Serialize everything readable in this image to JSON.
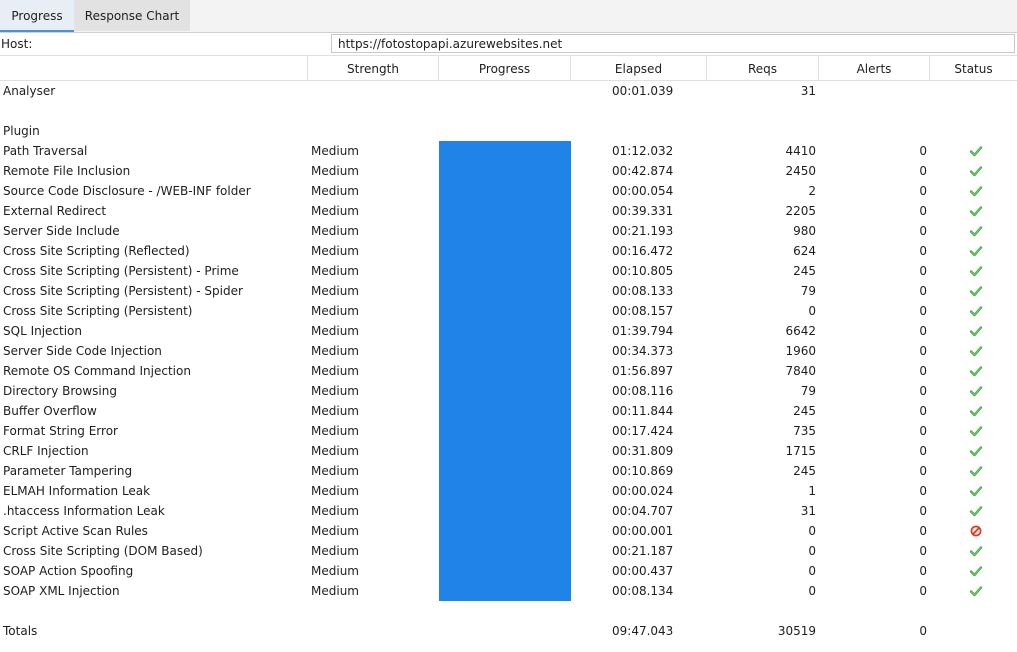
{
  "tabs": [
    {
      "label": "Progress",
      "active": true
    },
    {
      "label": "Response Chart",
      "active": false
    }
  ],
  "host": {
    "label": "Host:",
    "value": "https://fotostopapi.azurewebsites.net"
  },
  "columns": [
    "Strength",
    "Progress",
    "Elapsed",
    "Reqs",
    "Alerts",
    "Status"
  ],
  "analyser": {
    "name": "Analyser",
    "elapsed": "00:01.039",
    "reqs": "31"
  },
  "plugin_header": "Plugin",
  "plugins": [
    {
      "name": "Path Traversal",
      "strength": "Medium",
      "progress": 1.0,
      "elapsed": "01:12.032",
      "reqs": "4410",
      "alerts": "0",
      "status": "ok"
    },
    {
      "name": "Remote File Inclusion",
      "strength": "Medium",
      "progress": 1.0,
      "elapsed": "00:42.874",
      "reqs": "2450",
      "alerts": "0",
      "status": "ok"
    },
    {
      "name": "Source Code Disclosure - /WEB-INF folder",
      "strength": "Medium",
      "progress": 1.0,
      "elapsed": "00:00.054",
      "reqs": "2",
      "alerts": "0",
      "status": "ok"
    },
    {
      "name": "External Redirect",
      "strength": "Medium",
      "progress": 1.0,
      "elapsed": "00:39.331",
      "reqs": "2205",
      "alerts": "0",
      "status": "ok"
    },
    {
      "name": "Server Side Include",
      "strength": "Medium",
      "progress": 1.0,
      "elapsed": "00:21.193",
      "reqs": "980",
      "alerts": "0",
      "status": "ok"
    },
    {
      "name": "Cross Site Scripting (Reflected)",
      "strength": "Medium",
      "progress": 1.0,
      "elapsed": "00:16.472",
      "reqs": "624",
      "alerts": "0",
      "status": "ok"
    },
    {
      "name": "Cross Site Scripting (Persistent) - Prime",
      "strength": "Medium",
      "progress": 1.0,
      "elapsed": "00:10.805",
      "reqs": "245",
      "alerts": "0",
      "status": "ok"
    },
    {
      "name": "Cross Site Scripting (Persistent) - Spider",
      "strength": "Medium",
      "progress": 1.0,
      "elapsed": "00:08.133",
      "reqs": "79",
      "alerts": "0",
      "status": "ok"
    },
    {
      "name": "Cross Site Scripting (Persistent)",
      "strength": "Medium",
      "progress": 1.0,
      "elapsed": "00:08.157",
      "reqs": "0",
      "alerts": "0",
      "status": "ok"
    },
    {
      "name": "SQL Injection",
      "strength": "Medium",
      "progress": 1.0,
      "elapsed": "01:39.794",
      "reqs": "6642",
      "alerts": "0",
      "status": "ok"
    },
    {
      "name": "Server Side Code Injection",
      "strength": "Medium",
      "progress": 1.0,
      "elapsed": "00:34.373",
      "reqs": "1960",
      "alerts": "0",
      "status": "ok"
    },
    {
      "name": "Remote OS Command Injection",
      "strength": "Medium",
      "progress": 1.0,
      "elapsed": "01:56.897",
      "reqs": "7840",
      "alerts": "0",
      "status": "ok"
    },
    {
      "name": "Directory Browsing",
      "strength": "Medium",
      "progress": 1.0,
      "elapsed": "00:08.116",
      "reqs": "79",
      "alerts": "0",
      "status": "ok"
    },
    {
      "name": "Buffer Overflow",
      "strength": "Medium",
      "progress": 1.0,
      "elapsed": "00:11.844",
      "reqs": "245",
      "alerts": "0",
      "status": "ok"
    },
    {
      "name": "Format String Error",
      "strength": "Medium",
      "progress": 1.0,
      "elapsed": "00:17.424",
      "reqs": "735",
      "alerts": "0",
      "status": "ok"
    },
    {
      "name": "CRLF Injection",
      "strength": "Medium",
      "progress": 1.0,
      "elapsed": "00:31.809",
      "reqs": "1715",
      "alerts": "0",
      "status": "ok"
    },
    {
      "name": "Parameter Tampering",
      "strength": "Medium",
      "progress": 1.0,
      "elapsed": "00:10.869",
      "reqs": "245",
      "alerts": "0",
      "status": "ok"
    },
    {
      "name": "ELMAH Information Leak",
      "strength": "Medium",
      "progress": 1.0,
      "elapsed": "00:00.024",
      "reqs": "1",
      "alerts": "0",
      "status": "ok"
    },
    {
      "name": ".htaccess Information Leak",
      "strength": "Medium",
      "progress": 1.0,
      "elapsed": "00:04.707",
      "reqs": "31",
      "alerts": "0",
      "status": "ok"
    },
    {
      "name": "Script Active Scan Rules",
      "strength": "Medium",
      "progress": 1.0,
      "elapsed": "00:00.001",
      "reqs": "0",
      "alerts": "0",
      "status": "skipped"
    },
    {
      "name": "Cross Site Scripting (DOM Based)",
      "strength": "Medium",
      "progress": 1.0,
      "elapsed": "00:21.187",
      "reqs": "0",
      "alerts": "0",
      "status": "ok"
    },
    {
      "name": "SOAP Action Spoofing",
      "strength": "Medium",
      "progress": 1.0,
      "elapsed": "00:00.437",
      "reqs": "0",
      "alerts": "0",
      "status": "ok"
    },
    {
      "name": "SOAP XML Injection",
      "strength": "Medium",
      "progress": 1.0,
      "elapsed": "00:08.134",
      "reqs": "0",
      "alerts": "0",
      "status": "ok"
    }
  ],
  "totals": {
    "label": "Totals",
    "elapsed": "09:47.043",
    "reqs": "30519",
    "alerts": "0"
  },
  "colors": {
    "progress_bar": "#2083e8",
    "ok": "#3aa83a",
    "skipped": "#d9381e"
  },
  "icons": {
    "ok": "check-icon",
    "skipped": "no-entry-icon"
  }
}
